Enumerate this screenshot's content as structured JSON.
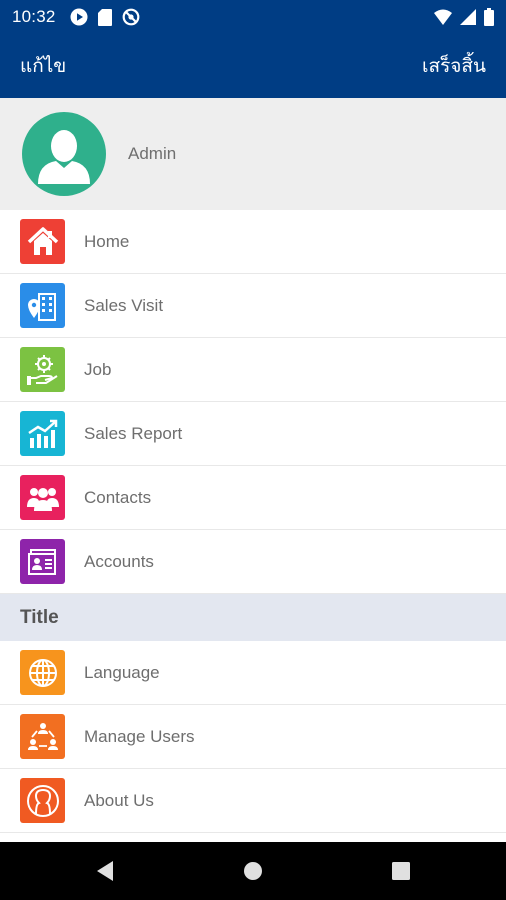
{
  "status_bar": {
    "time": "10:32",
    "left_icons": [
      "play-icon",
      "sd-card-icon",
      "no-data-icon"
    ],
    "right_icons": [
      "wifi-icon",
      "signal-icon",
      "battery-icon"
    ]
  },
  "app_bar": {
    "left_action": "แก้ไข",
    "right_action": "เสร็จสิ้น",
    "background": "#003d84"
  },
  "profile": {
    "name": "Admin",
    "avatar_color": "#2fb08c"
  },
  "menu": {
    "items": [
      {
        "label": "Home",
        "icon": "home-icon",
        "color": "#ee4035"
      },
      {
        "label": "Sales Visit",
        "icon": "building-location-icon",
        "color": "#2a8de8"
      },
      {
        "label": "Job",
        "icon": "job-gear-hand-icon",
        "color": "#7cc242"
      },
      {
        "label": "Sales Report",
        "icon": "bar-chart-icon",
        "color": "#17b5d4"
      },
      {
        "label": "Contacts",
        "icon": "people-group-icon",
        "color": "#e8215e"
      },
      {
        "label": "Accounts",
        "icon": "id-card-icon",
        "color": "#8e24aa"
      }
    ]
  },
  "section": {
    "title": "Title",
    "items": [
      {
        "label": "Language",
        "icon": "globe-icon",
        "color": "#f7941d"
      },
      {
        "label": "Manage Users",
        "icon": "user-network-icon",
        "color": "#f26f21"
      },
      {
        "label": "About Us",
        "icon": "person-outline-icon",
        "color": "#f05a22"
      }
    ]
  },
  "nav_bar": {
    "buttons": [
      "back-icon",
      "home-circle-icon",
      "recents-square-icon"
    ]
  }
}
